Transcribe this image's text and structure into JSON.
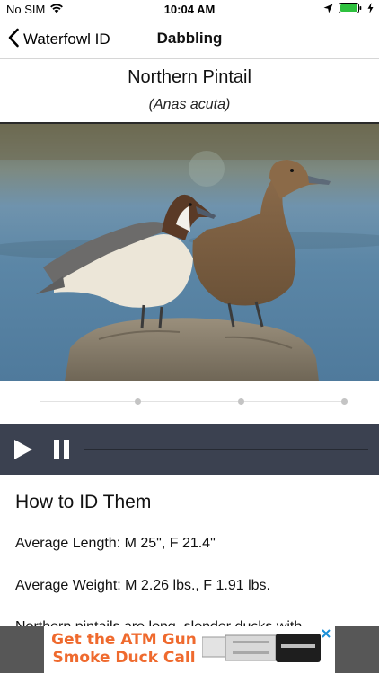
{
  "status": {
    "carrier": "No SIM",
    "time": "10:04 AM"
  },
  "nav": {
    "back_label": "Waterfowl ID",
    "title": "Dabbling"
  },
  "species": {
    "common_name": "Northern Pintail",
    "latin_name": "(Anas acuta)"
  },
  "gallery": {
    "page_count": 3,
    "current_page": 1
  },
  "audio": {
    "progress": 0.0
  },
  "content": {
    "heading": "How to ID Them",
    "length": "Average Length: M 25\", F 21.4\"",
    "weight": "Average Weight: M 2.26 lbs., F 1.91 lbs.",
    "description": "Northern pintails are long, slender ducks with"
  },
  "ad": {
    "line1": "Get the ATM Gun",
    "line2": "Smoke Duck Call"
  },
  "colors": {
    "audio_bar": "#3b4150",
    "ad_text": "#ef6a2e",
    "ad_frame": "#575757"
  }
}
